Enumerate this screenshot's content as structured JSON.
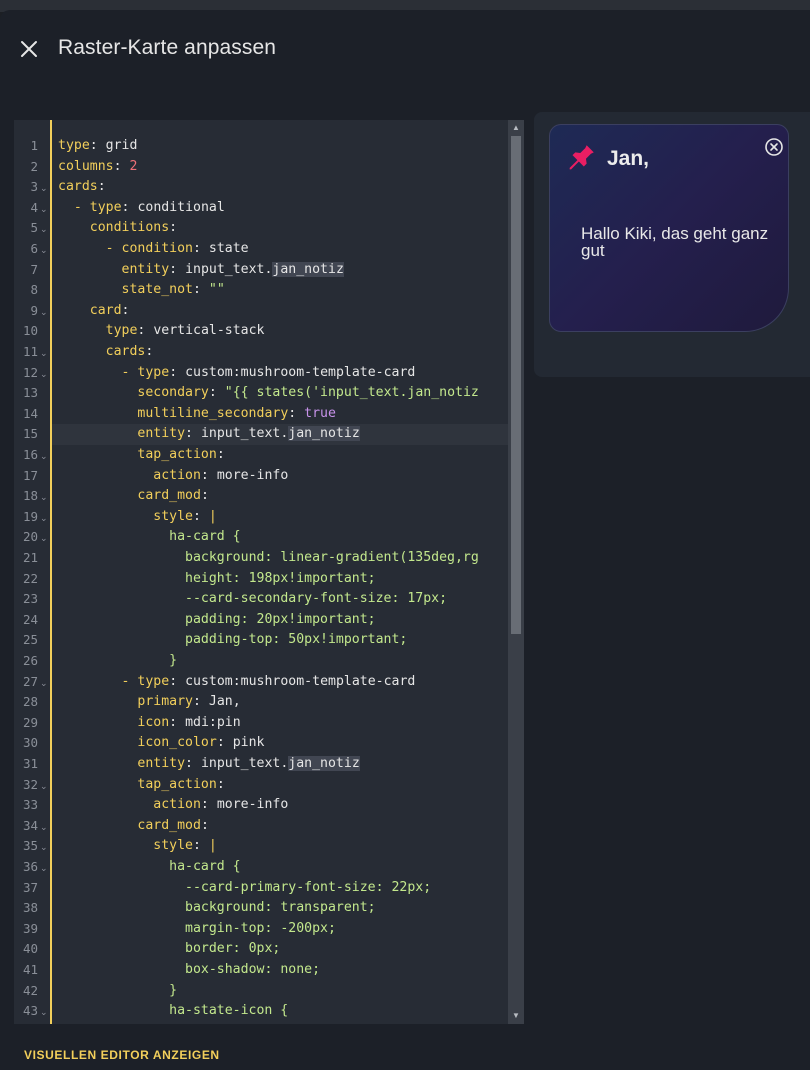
{
  "dialog": {
    "title": "Raster-Karte anpassen",
    "close_icon": "close-icon",
    "visual_editor_label": "VISUELLEN EDITOR ANZEIGEN"
  },
  "colors": {
    "accent": "#f2cf5b",
    "key": "#f07178",
    "string": "#c3e88d",
    "boolean": "#c792ea",
    "pin": "#e91e63"
  },
  "editor": {
    "active_line": 15,
    "lines": [
      {
        "n": "1",
        "fold": false,
        "indent": "",
        "key": "type",
        "val": "grid",
        "type": "v"
      },
      {
        "n": "2",
        "fold": false,
        "indent": "",
        "key": "columns",
        "val": "2",
        "type": "num"
      },
      {
        "n": "3",
        "fold": true,
        "indent": "",
        "key": "cards",
        "val": "",
        "type": "v"
      },
      {
        "n": "4",
        "fold": true,
        "indent": "  - ",
        "key": "type",
        "val": "conditional",
        "type": "v"
      },
      {
        "n": "5",
        "fold": true,
        "indent": "    ",
        "key": "conditions",
        "val": "",
        "type": "v"
      },
      {
        "n": "6",
        "fold": true,
        "indent": "      - ",
        "key": "condition",
        "val": "state",
        "type": "v"
      },
      {
        "n": "7",
        "fold": false,
        "indent": "        ",
        "key": "entity",
        "val": "input_text.jan_notiz",
        "type": "ent"
      },
      {
        "n": "8",
        "fold": false,
        "indent": "        ",
        "key": "state_not",
        "val": "\"\"",
        "type": "s"
      },
      {
        "n": "9",
        "fold": true,
        "indent": "    ",
        "key": "card",
        "val": "",
        "type": "v"
      },
      {
        "n": "10",
        "fold": false,
        "indent": "      ",
        "key": "type",
        "val": "vertical-stack",
        "type": "v"
      },
      {
        "n": "11",
        "fold": true,
        "indent": "      ",
        "key": "cards",
        "val": "",
        "type": "v"
      },
      {
        "n": "12",
        "fold": true,
        "indent": "        - ",
        "key": "type",
        "val": "custom:mushroom-template-card",
        "type": "v"
      },
      {
        "n": "13",
        "fold": false,
        "indent": "          ",
        "key": "secondary",
        "val": "\"{{ states('input_text.jan_notiz",
        "type": "s"
      },
      {
        "n": "14",
        "fold": false,
        "indent": "          ",
        "key": "multiline_secondary",
        "val": "true",
        "type": "bool"
      },
      {
        "n": "15",
        "fold": false,
        "indent": "          ",
        "key": "entity",
        "val": "input_text.jan_notiz",
        "type": "ent"
      },
      {
        "n": "16",
        "fold": true,
        "indent": "          ",
        "key": "tap_action",
        "val": "",
        "type": "v"
      },
      {
        "n": "17",
        "fold": false,
        "indent": "            ",
        "key": "action",
        "val": "more-info",
        "type": "v"
      },
      {
        "n": "18",
        "fold": true,
        "indent": "          ",
        "key": "card_mod",
        "val": "",
        "type": "v"
      },
      {
        "n": "19",
        "fold": true,
        "indent": "            ",
        "key": "style",
        "val": "|",
        "type": "pipe"
      },
      {
        "n": "20",
        "fold": true,
        "indent": "              ",
        "key": "",
        "val": "ha-card {",
        "type": "s"
      },
      {
        "n": "21",
        "fold": false,
        "indent": "                ",
        "key": "",
        "val": "background: linear-gradient(135deg,rg",
        "type": "s"
      },
      {
        "n": "22",
        "fold": false,
        "indent": "                ",
        "key": "",
        "val": "height: 198px!important;",
        "type": "s"
      },
      {
        "n": "23",
        "fold": false,
        "indent": "                ",
        "key": "",
        "val": "--card-secondary-font-size: 17px;",
        "type": "s"
      },
      {
        "n": "24",
        "fold": false,
        "indent": "                ",
        "key": "",
        "val": "padding: 20px!important;",
        "type": "s"
      },
      {
        "n": "25",
        "fold": false,
        "indent": "                ",
        "key": "",
        "val": "padding-top: 50px!important;",
        "type": "s"
      },
      {
        "n": "26",
        "fold": false,
        "indent": "              ",
        "key": "",
        "val": "}",
        "type": "s"
      },
      {
        "n": "27",
        "fold": true,
        "indent": "        - ",
        "key": "type",
        "val": "custom:mushroom-template-card",
        "type": "v"
      },
      {
        "n": "28",
        "fold": false,
        "indent": "          ",
        "key": "primary",
        "val": "Jan,",
        "type": "v"
      },
      {
        "n": "29",
        "fold": false,
        "indent": "          ",
        "key": "icon",
        "val": "mdi:pin",
        "type": "v"
      },
      {
        "n": "30",
        "fold": false,
        "indent": "          ",
        "key": "icon_color",
        "val": "pink",
        "type": "v"
      },
      {
        "n": "31",
        "fold": false,
        "indent": "          ",
        "key": "entity",
        "val": "input_text.jan_notiz",
        "type": "ent"
      },
      {
        "n": "32",
        "fold": true,
        "indent": "          ",
        "key": "tap_action",
        "val": "",
        "type": "v"
      },
      {
        "n": "33",
        "fold": false,
        "indent": "            ",
        "key": "action",
        "val": "more-info",
        "type": "v"
      },
      {
        "n": "34",
        "fold": true,
        "indent": "          ",
        "key": "card_mod",
        "val": "",
        "type": "v"
      },
      {
        "n": "35",
        "fold": true,
        "indent": "            ",
        "key": "style",
        "val": "|",
        "type": "pipe"
      },
      {
        "n": "36",
        "fold": true,
        "indent": "              ",
        "key": "",
        "val": "ha-card {",
        "type": "s"
      },
      {
        "n": "37",
        "fold": false,
        "indent": "                ",
        "key": "",
        "val": "--card-primary-font-size: 22px;",
        "type": "s"
      },
      {
        "n": "38",
        "fold": false,
        "indent": "                ",
        "key": "",
        "val": "background: transparent;",
        "type": "s"
      },
      {
        "n": "39",
        "fold": false,
        "indent": "                ",
        "key": "",
        "val": "margin-top: -200px;",
        "type": "s"
      },
      {
        "n": "40",
        "fold": false,
        "indent": "                ",
        "key": "",
        "val": "border: 0px;",
        "type": "s"
      },
      {
        "n": "41",
        "fold": false,
        "indent": "                ",
        "key": "",
        "val": "box-shadow: none;",
        "type": "s"
      },
      {
        "n": "42",
        "fold": false,
        "indent": "              ",
        "key": "",
        "val": "}",
        "type": "s"
      },
      {
        "n": "43",
        "fold": true,
        "indent": "              ",
        "key": "",
        "val": "ha-state-icon {",
        "type": "s"
      }
    ]
  },
  "preview_card": {
    "primary": "Jan,",
    "secondary": "Hallo Kiki, das geht ganz gut",
    "icon": "pin-icon",
    "close_icon": "close-circle-icon"
  }
}
